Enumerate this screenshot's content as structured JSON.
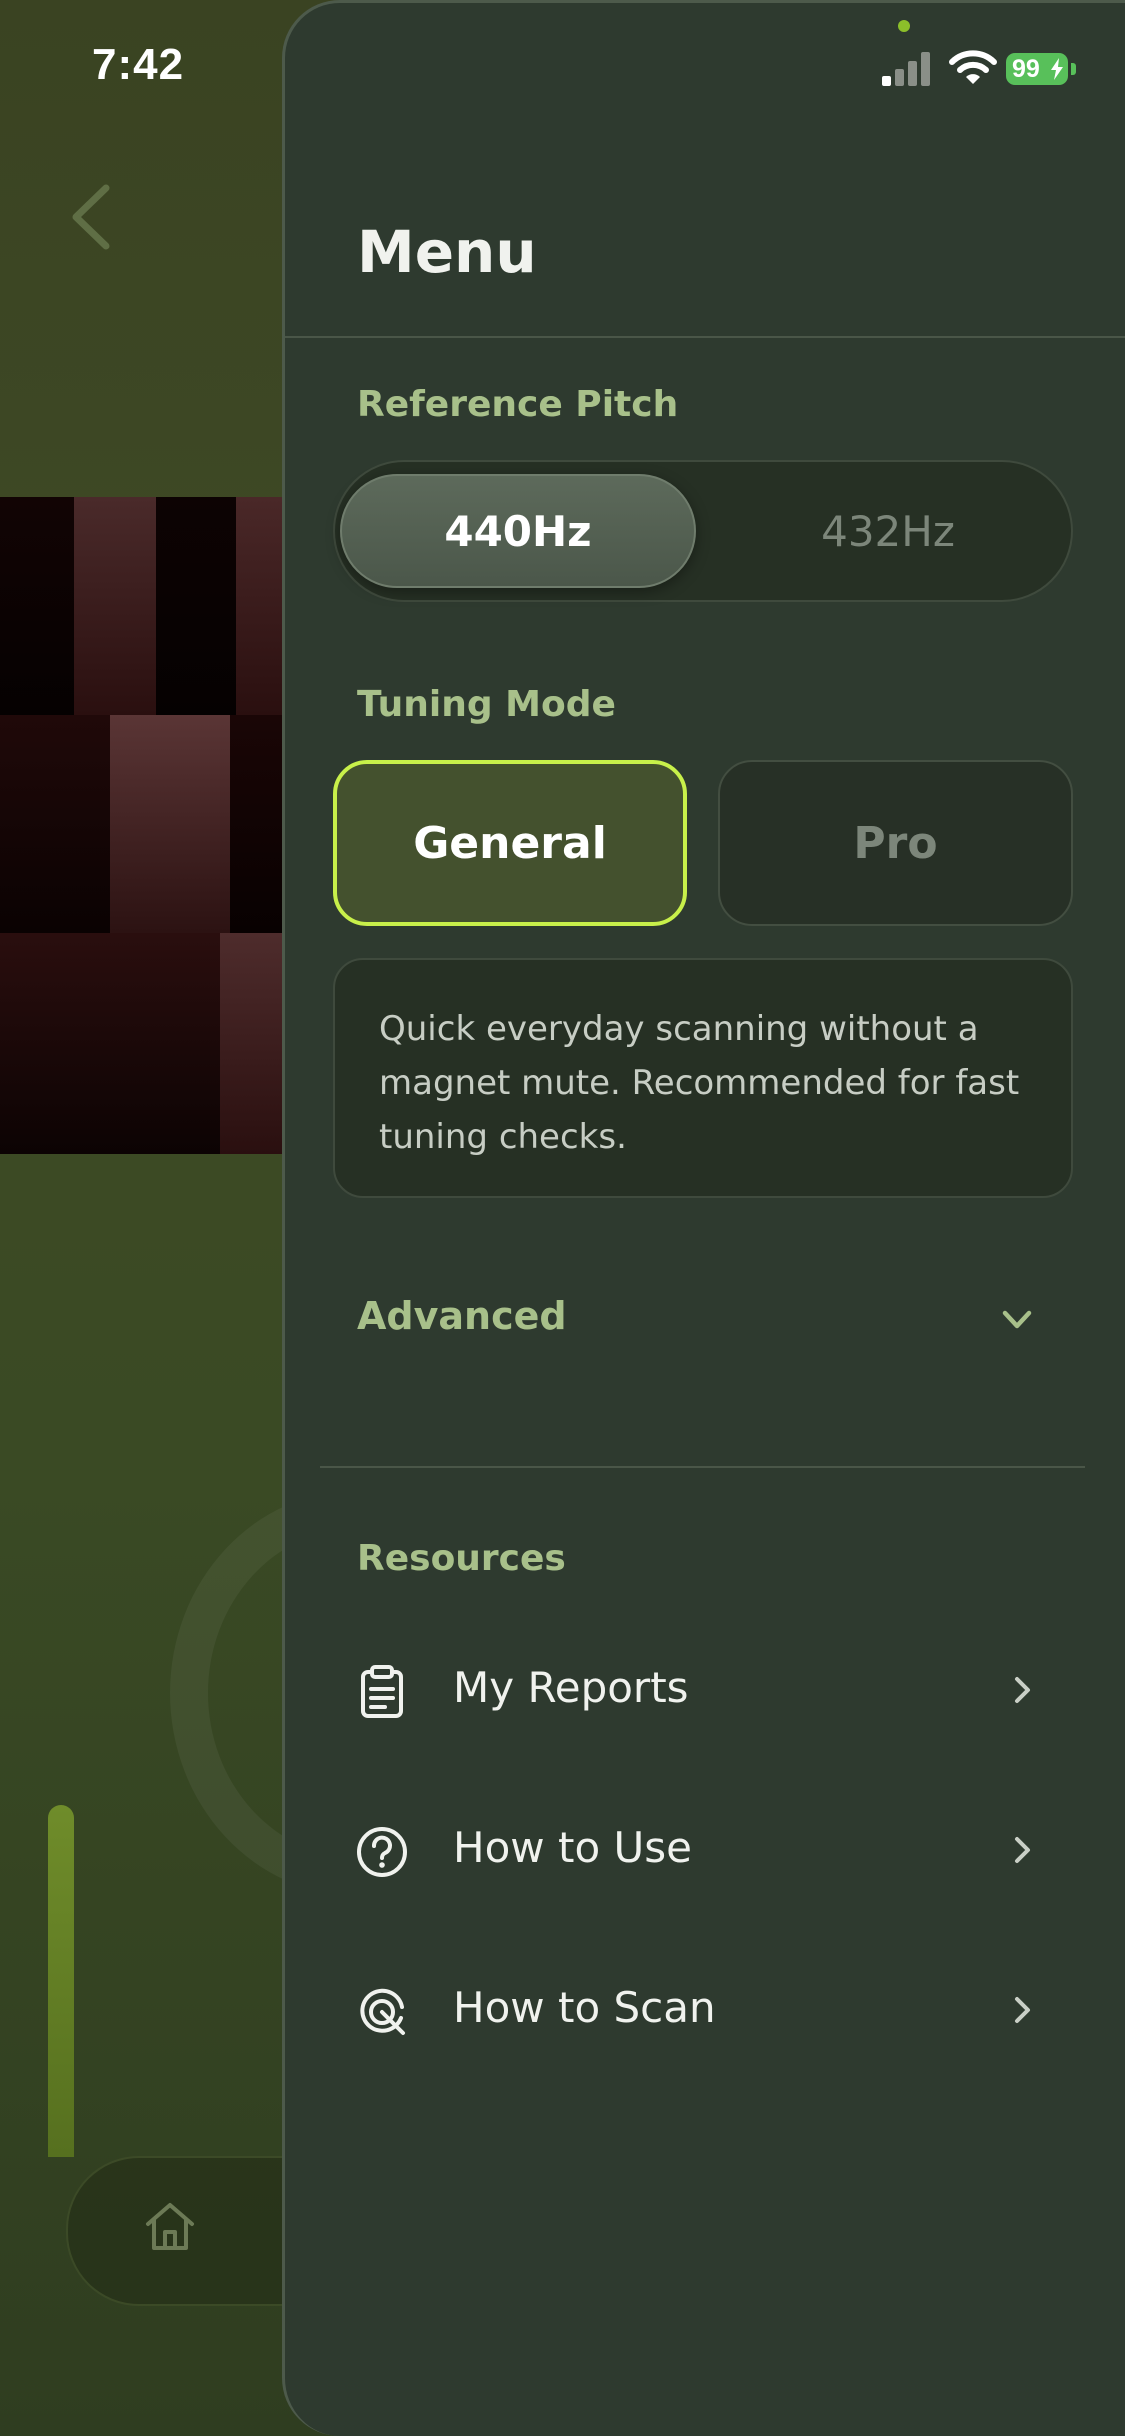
{
  "status_bar": {
    "time": "7:42",
    "battery": "99"
  },
  "menu": {
    "title": "Menu",
    "reference_pitch": {
      "label": "Reference Pitch",
      "options": [
        "440Hz",
        "432Hz"
      ],
      "selected": "440Hz"
    },
    "tuning_mode": {
      "label": "Tuning Mode",
      "options": [
        "General",
        "Pro"
      ],
      "selected": "General",
      "description": "Quick everyday scanning without a magnet mute. Recommended for fast tuning checks."
    },
    "advanced": {
      "label": "Advanced",
      "expanded": false
    },
    "resources": {
      "label": "Resources",
      "items": [
        {
          "label": "My Reports",
          "icon": "clipboard-icon"
        },
        {
          "label": "How to Use",
          "icon": "question-circle-icon"
        },
        {
          "label": "How to Scan",
          "icon": "target-icon"
        }
      ]
    }
  },
  "colors": {
    "accent": "#c8f04a",
    "section_label": "#a8c08a",
    "drawer_bg": "#2e3a2f",
    "selected_mode_bg": "#44512e"
  }
}
